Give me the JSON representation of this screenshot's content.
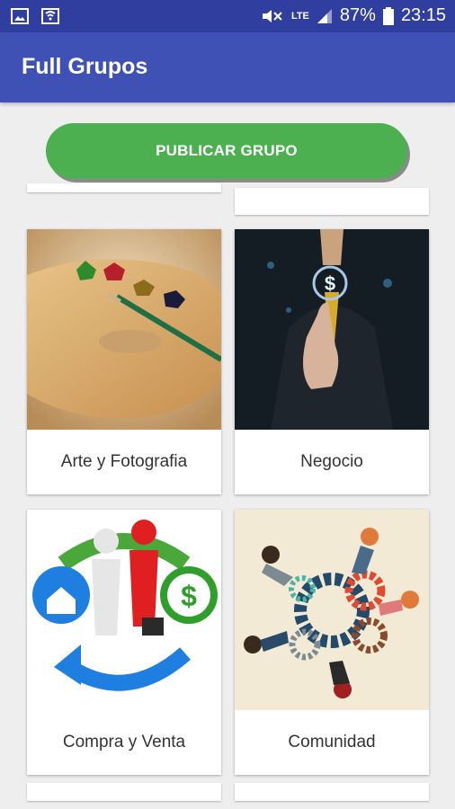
{
  "status_bar": {
    "battery": "87%",
    "time": "23:15",
    "network": "LTE",
    "icons": [
      "image-icon",
      "keyboard-icon",
      "mute-icon",
      "lte-icon",
      "signal-icon",
      "battery-icon"
    ]
  },
  "app_bar": {
    "title": "Full Grupos"
  },
  "publish_button": {
    "label": "PUBLICAR GRUPO",
    "color": "#4caf50"
  },
  "categories": [
    {
      "label": "Arte y Fotografia",
      "image": "paint-palette-image"
    },
    {
      "label": "Negocio",
      "image": "businessman-touch-dollar-image"
    },
    {
      "label": "Compra y Venta",
      "image": "handshake-dollar-house-image"
    },
    {
      "label": "Comunidad",
      "image": "people-gears-image"
    }
  ],
  "colors": {
    "status_bar": "#303f9f",
    "app_bar": "#3f51b5",
    "background": "#eeeeee"
  }
}
